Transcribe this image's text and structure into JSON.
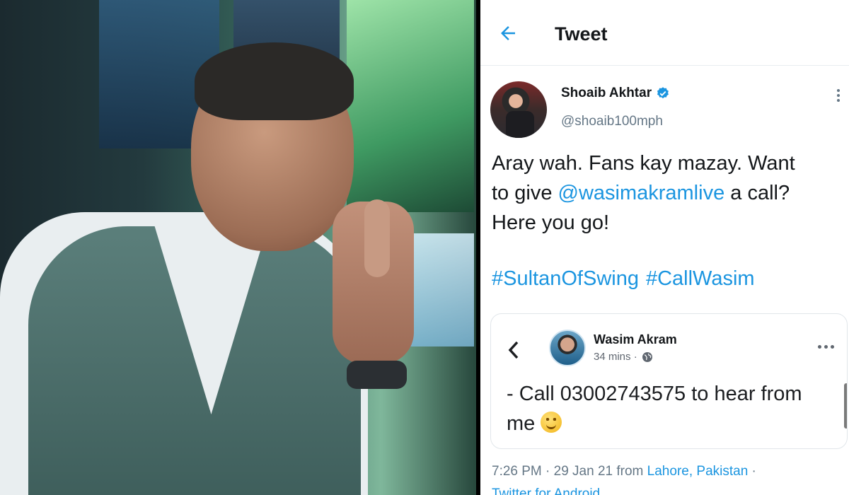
{
  "header": {
    "title": "Tweet",
    "back_icon": "arrow-left-icon"
  },
  "author": {
    "name": "Shoaib Akhtar",
    "handle": "@shoaib100mph",
    "verified_icon": "verified-badge-icon"
  },
  "tweet": {
    "line1": "Aray wah. Fans kay mazay. Want",
    "line2_prefix": "to give ",
    "mention": "@wasimakramlive",
    "line2_suffix": " a call?",
    "line3": "Here you go!",
    "hashtags": [
      "#SultanOfSwing",
      "#CallWasim"
    ]
  },
  "embedded_post": {
    "name": "Wasim Akram",
    "time": "34 mins ·",
    "text_line1": "- Call 03002743575 to hear from",
    "text_line2": "me",
    "emoji_icon": "smiling-face-icon"
  },
  "meta": {
    "time_date": "7:26 PM · 29 Jan 21 from ",
    "location": "Lahore, Pakistan",
    "separator": " ·",
    "client": "Twitter for Android"
  },
  "colors": {
    "link": "#1b95e0",
    "text": "#14171a",
    "muted": "#657786"
  }
}
